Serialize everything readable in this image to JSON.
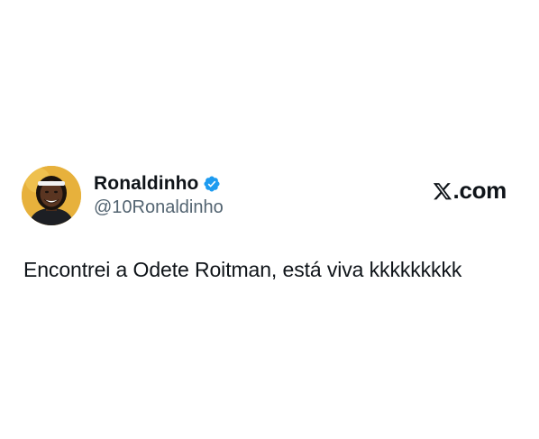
{
  "tweet": {
    "author": {
      "display_name": "Ronaldinho",
      "handle": "@10Ronaldinho",
      "verified": true,
      "avatar_icon": "profile-photo",
      "verified_icon": "verified-badge-icon",
      "verified_color": "#1d9bf0"
    },
    "source": {
      "logo_icon": "x-logo-icon",
      "domain_suffix": ".com"
    },
    "text": "Encontrei a Odete Roitman, está viva kkkkkkkkk"
  },
  "colors": {
    "background": "#ffffff",
    "text_primary": "#0f1419",
    "text_secondary": "#536471",
    "avatar_background": "#e9b23a"
  }
}
